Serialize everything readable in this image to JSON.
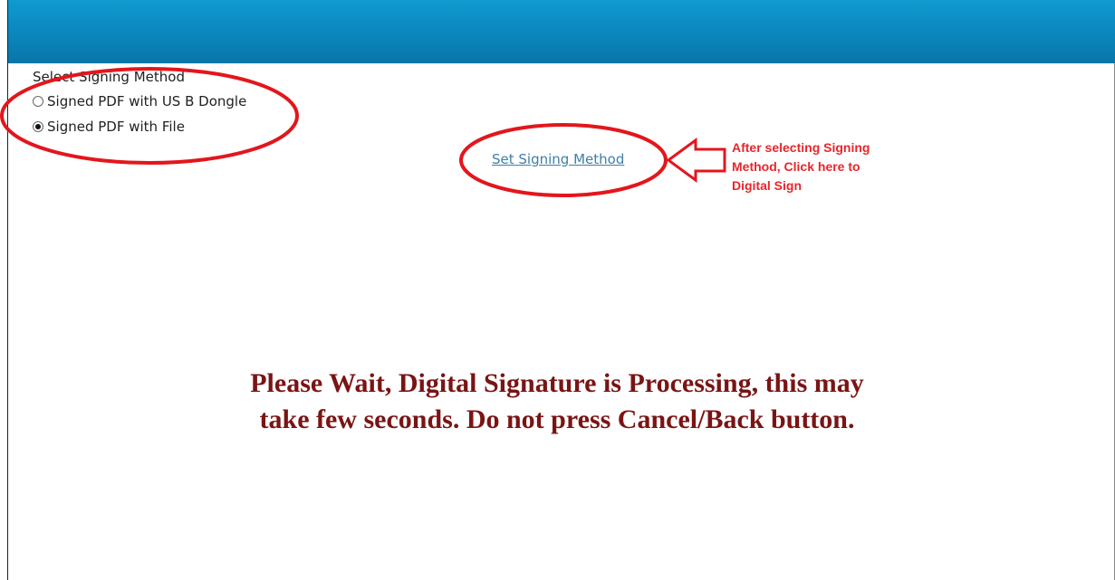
{
  "signing_method": {
    "label": "Select Signing Method",
    "options": [
      {
        "label": "Signed PDF with US B Dongle",
        "selected": false
      },
      {
        "label": "Signed PDF with File",
        "selected": true
      }
    ]
  },
  "set_signing_link": "Set Signing Method",
  "annotation": {
    "lines": [
      "After selecting Signing",
      "Method, Click here to",
      "Digital Sign"
    ],
    "color": "#e8262b"
  },
  "wait_message": {
    "line1": "Please Wait, Digital Signature is Processing, this may",
    "line2": "take few seconds. Do not press Cancel/Back button.",
    "color": "#7a1414"
  },
  "header_color": "#0b86bd",
  "link_color": "#3e7fa6"
}
